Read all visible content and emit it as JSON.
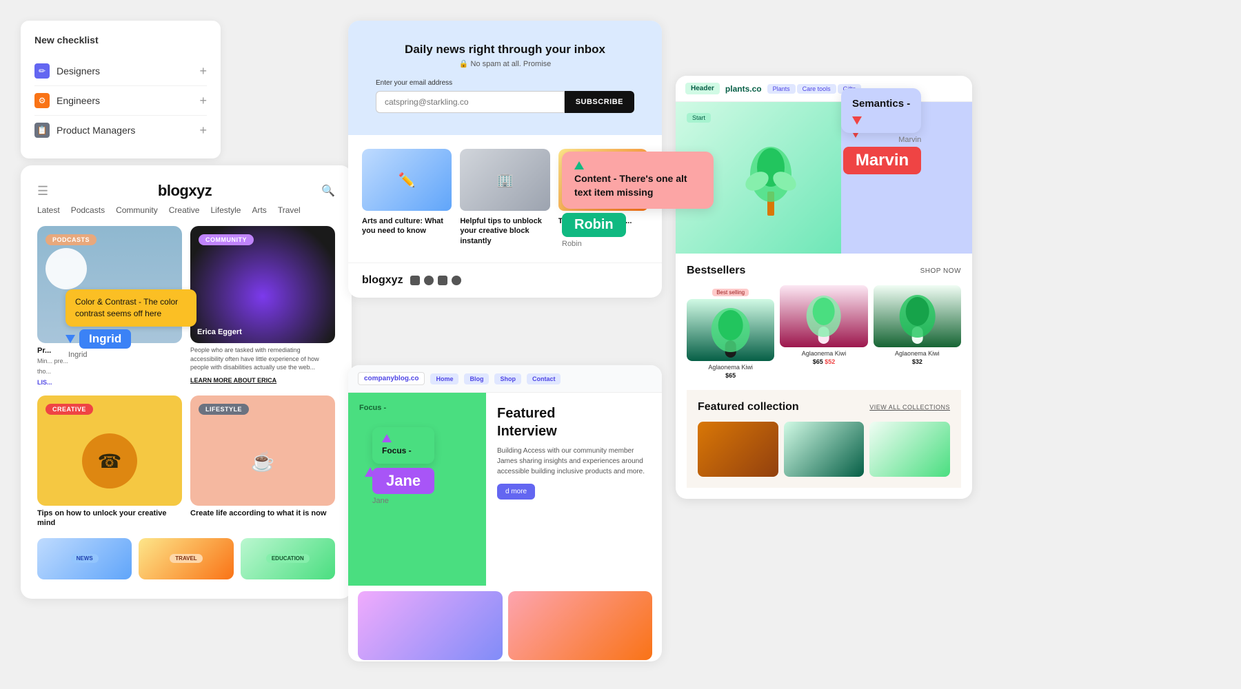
{
  "checklist": {
    "title": "New checklist",
    "items": [
      {
        "id": "designers",
        "label": "Designers",
        "icon": "pencil-icon",
        "icon_type": "blue"
      },
      {
        "id": "engineers",
        "label": "Engineers",
        "icon": "gear-icon",
        "icon_type": "orange"
      },
      {
        "id": "product-managers",
        "label": "Product Managers",
        "icon": "doc-icon",
        "icon_type": "gray"
      }
    ],
    "add_label": "+"
  },
  "blog_preview": {
    "logo": "blogxyz",
    "nav_items": [
      "Latest",
      "Podcasts",
      "Community",
      "Creative",
      "Lifestyle",
      "Arts",
      "Travel"
    ],
    "cards": [
      {
        "tag": "PODCASTS",
        "tag_class": "tag-podcasts",
        "card_class": "blog-card-podcasts"
      },
      {
        "tag": "COMMUNITY",
        "tag_class": "tag-community",
        "card_class": "blog-card-community",
        "person_name": "Erica Eggert",
        "description": "People who are tasked with remediating accessibility often have little experience of how people with disabilities actually use the web...",
        "learn_more": "LEARN MORE ABOUT ERICA"
      },
      {
        "tag": "CREATIVE",
        "tag_class": "tag-creative",
        "card_class": "blog-card-creative",
        "title": "Tips on how to unlock your creative mind"
      },
      {
        "tag": "LIFESTYLE",
        "tag_class": "tag-lifestyle",
        "card_class": "blog-card-lifestyle",
        "title": "Create life according to what it is now"
      }
    ]
  },
  "ingrid_annotation": {
    "bubble_text": "Color & Contrast - The color contrast seems off here",
    "user_name": "Ingrid",
    "cursor_color": "#3b82f6"
  },
  "newsletter": {
    "title": "Daily news right through your inbox",
    "subtitle": "🔒 No spam at all. Promise",
    "email_label": "Enter your email address",
    "email_placeholder": "catspring@starkling.co",
    "subscribe_btn": "SUBSCRIBE",
    "footer_logo": "blogxyz",
    "social_count": 4
  },
  "articles": [
    {
      "title": "Arts and culture: What you need to know",
      "img_class": "article-img-blue"
    },
    {
      "title": "Helpful tips to unblock your creative block instantly",
      "img_class": "article-img-teal"
    },
    {
      "title": "Top tricks to travel...",
      "img_class": "article-img-pink"
    }
  ],
  "robin_annotation": {
    "bubble_text": "Content - There's one alt text item missing",
    "user_name": "Robin",
    "cursor_color": "#10b981"
  },
  "company_blog": {
    "url": "companyblog.co",
    "nav_items": [
      "Home",
      "Blog",
      "Shop",
      "Contact"
    ],
    "featured_label": "Focus -",
    "featured_title": "Featured Interview",
    "featured_text": "Building Access with our community member James sharing insights and experiences around accessible building inclusive products and more.",
    "read_more": "d more"
  },
  "jane_annotation": {
    "bubble_text": "Focus -",
    "user_name": "Jane",
    "cursor_color": "#a855f7"
  },
  "plants_store": {
    "header_label": "plants.co",
    "nav_items": [
      "Plants",
      "Care tools",
      "Gifts"
    ],
    "semantics_text": "Semantics -",
    "marvin_name": "Marvin",
    "bestsellers_title": "Bestsellers",
    "shop_now": "SHOP NOW",
    "plants": [
      {
        "name": "Aglaonema Kiwi",
        "price": "$65",
        "badge": "Best selling"
      },
      {
        "name": "Aglaonema Kiwi",
        "price": "$65",
        "sale_price": "$52",
        "badge": ""
      },
      {
        "name": "Aglaonema Kiwi",
        "price": "$32",
        "badge": ""
      }
    ],
    "featured_collection_title": "Featured collection",
    "view_all": "VIEW ALL COLLECTIONS"
  }
}
